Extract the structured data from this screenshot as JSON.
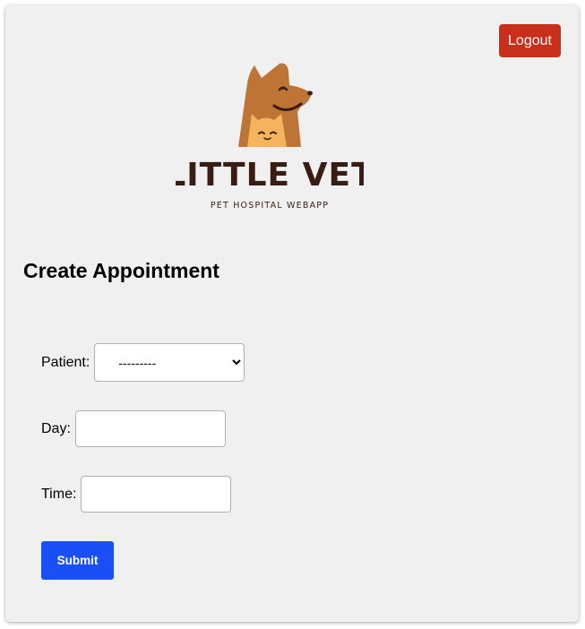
{
  "header": {
    "logout_label": "Logout"
  },
  "logo": {
    "brand_name": "LITTLE VET",
    "tagline": "PET HOSPITAL WEBAPP",
    "icon": "dog-and-cat-logo"
  },
  "page_title": "Create Appointment",
  "form": {
    "patient": {
      "label": "Patient:",
      "selected": "---------",
      "options": [
        "---------"
      ]
    },
    "day": {
      "label": "Day:",
      "value": ""
    },
    "time": {
      "label": "Time:",
      "value": ""
    },
    "submit_label": "Submit"
  },
  "colors": {
    "card_background": "#f0f0f0",
    "logout_button": "#c8301c",
    "submit_button": "#1a4ff5",
    "logo_dog": "#bd7434",
    "logo_cat": "#f6b35e",
    "logo_text": "#3a1d12"
  }
}
